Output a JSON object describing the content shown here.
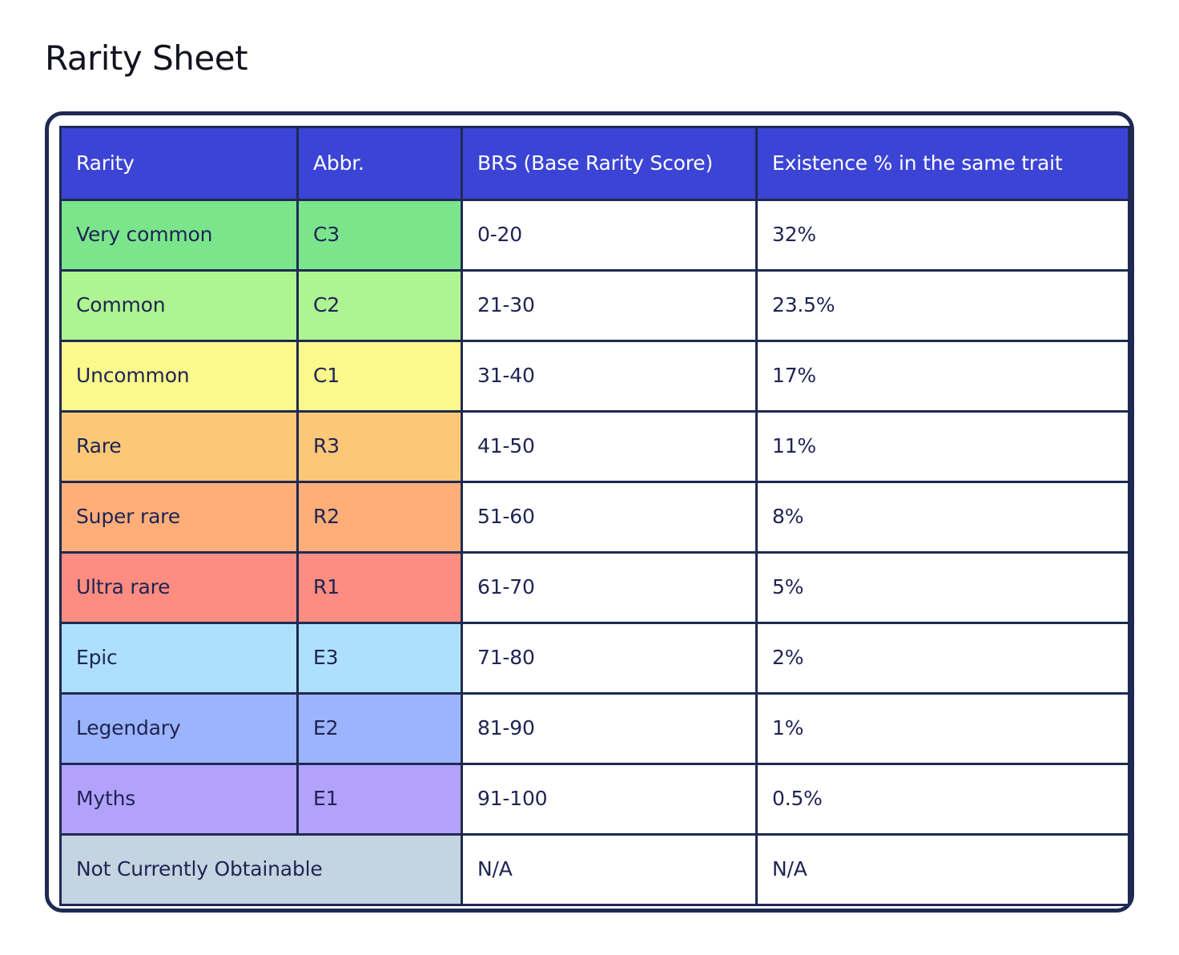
{
  "page": {
    "title": "Rarity Sheet"
  },
  "table": {
    "columns": [
      {
        "key": "rarity",
        "label": "Rarity"
      },
      {
        "key": "abbr",
        "label": "Abbr."
      },
      {
        "key": "brs",
        "label": "BRS (Base Rarity Score)"
      },
      {
        "key": "existence",
        "label": "Existence % in the same trait"
      }
    ],
    "rows": [
      {
        "rarity": "Very common",
        "abbr": "C3",
        "brs": "0-20",
        "existence": "32%",
        "color": "#7be58c"
      },
      {
        "rarity": "Common",
        "abbr": "C2",
        "brs": "21-30",
        "existence": "23.5%",
        "color": "#aef490"
      },
      {
        "rarity": "Uncommon",
        "abbr": "C1",
        "brs": "31-40",
        "existence": "17%",
        "color": "#fbf98c"
      },
      {
        "rarity": "Rare",
        "abbr": "R3",
        "brs": "41-50",
        "existence": "11%",
        "color": "#fcc878"
      },
      {
        "rarity": "Super rare",
        "abbr": "R2",
        "brs": "51-60",
        "existence": "8%",
        "color": "#ffae79"
      },
      {
        "rarity": "Ultra rare",
        "abbr": "R1",
        "brs": "61-70",
        "existence": "5%",
        "color": "#fc8d80"
      },
      {
        "rarity": "Epic",
        "abbr": "E3",
        "brs": "71-80",
        "existence": "2%",
        "color": "#aee0fb"
      },
      {
        "rarity": "Legendary",
        "abbr": "E2",
        "brs": "81-90",
        "existence": "1%",
        "color": "#9cb4fb"
      },
      {
        "rarity": "Myths",
        "abbr": "E1",
        "brs": "91-100",
        "existence": "0.5%",
        "color": "#b3a2fb"
      },
      {
        "rarity": "Not Currently Obtainable",
        "abbr": null,
        "brs": "N/A",
        "existence": "N/A",
        "color": "#c4d4e0",
        "span_first_two": true
      }
    ]
  },
  "colors": {
    "header_background": "#3b44d4",
    "header_text": "#ffffff",
    "border": "#1f2a52",
    "body_text": "#1e2453",
    "page_background": "#ffffff",
    "title_text": "#11131f"
  }
}
